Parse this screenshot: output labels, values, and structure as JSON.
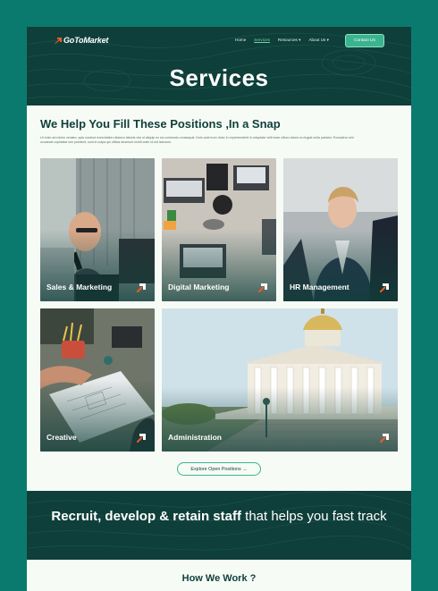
{
  "brand": {
    "name": "GoToMarket"
  },
  "nav": {
    "items": [
      "Home",
      "Services",
      "Resources ▾",
      "About Us ▾"
    ],
    "cta": "Contact Us"
  },
  "hero": {
    "title": "Services"
  },
  "intro": {
    "heading": "We Help You Fill These Positions ,In a Snap",
    "body": "Ut enim ad minim veniam, quis nostrud exercitation ullamco laboris nisi ut aliquip ex ea commodo consequat. Duis aute irure dolor in reprehenderit in voluptate velit esse cillum dolore eu fugiat nulla pariatur. Excepteur sint occaecat cupidatat non proident, sunt in culpa qui officia deserunt mollit anim id est laborum."
  },
  "services": [
    {
      "label": "Sales & Marketing"
    },
    {
      "label": "Digital Marketing"
    },
    {
      "label": "HR Management"
    },
    {
      "label": "Creative"
    },
    {
      "label": "Administration"
    }
  ],
  "explore": {
    "label": "Explore Open Positions →"
  },
  "band": {
    "bold": "Recruit, develop & retain staff",
    "rest": " that helps you fast track"
  },
  "how": {
    "title": "How We Work ?"
  },
  "colors": {
    "dark": "#0f3f3a",
    "accent": "#3ab48f",
    "frame": "#0b7a6e",
    "arrow": "#f05a28"
  }
}
